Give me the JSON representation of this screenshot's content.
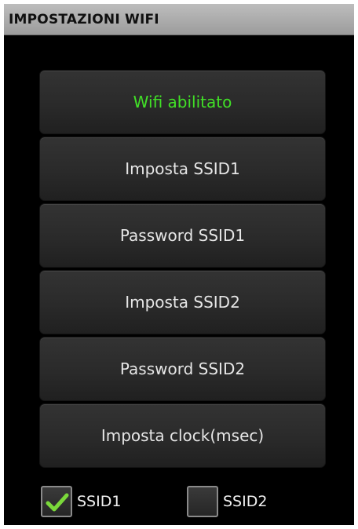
{
  "window": {
    "title": "IMPOSTAZIONI WIFI"
  },
  "menu": {
    "items": [
      {
        "label": "Wifi abilitato",
        "active": true,
        "color": "#41e027"
      },
      {
        "label": "Imposta SSID1",
        "active": false
      },
      {
        "label": "Password SSID1",
        "active": false
      },
      {
        "label": "Imposta SSID2",
        "active": false
      },
      {
        "label": "Password SSID2",
        "active": false
      },
      {
        "label": "Imposta clock(msec)",
        "active": false
      }
    ]
  },
  "checkboxes": [
    {
      "label": "SSID1",
      "checked": true,
      "check_color": "#7ad83a"
    },
    {
      "label": "SSID2",
      "checked": false
    }
  ]
}
